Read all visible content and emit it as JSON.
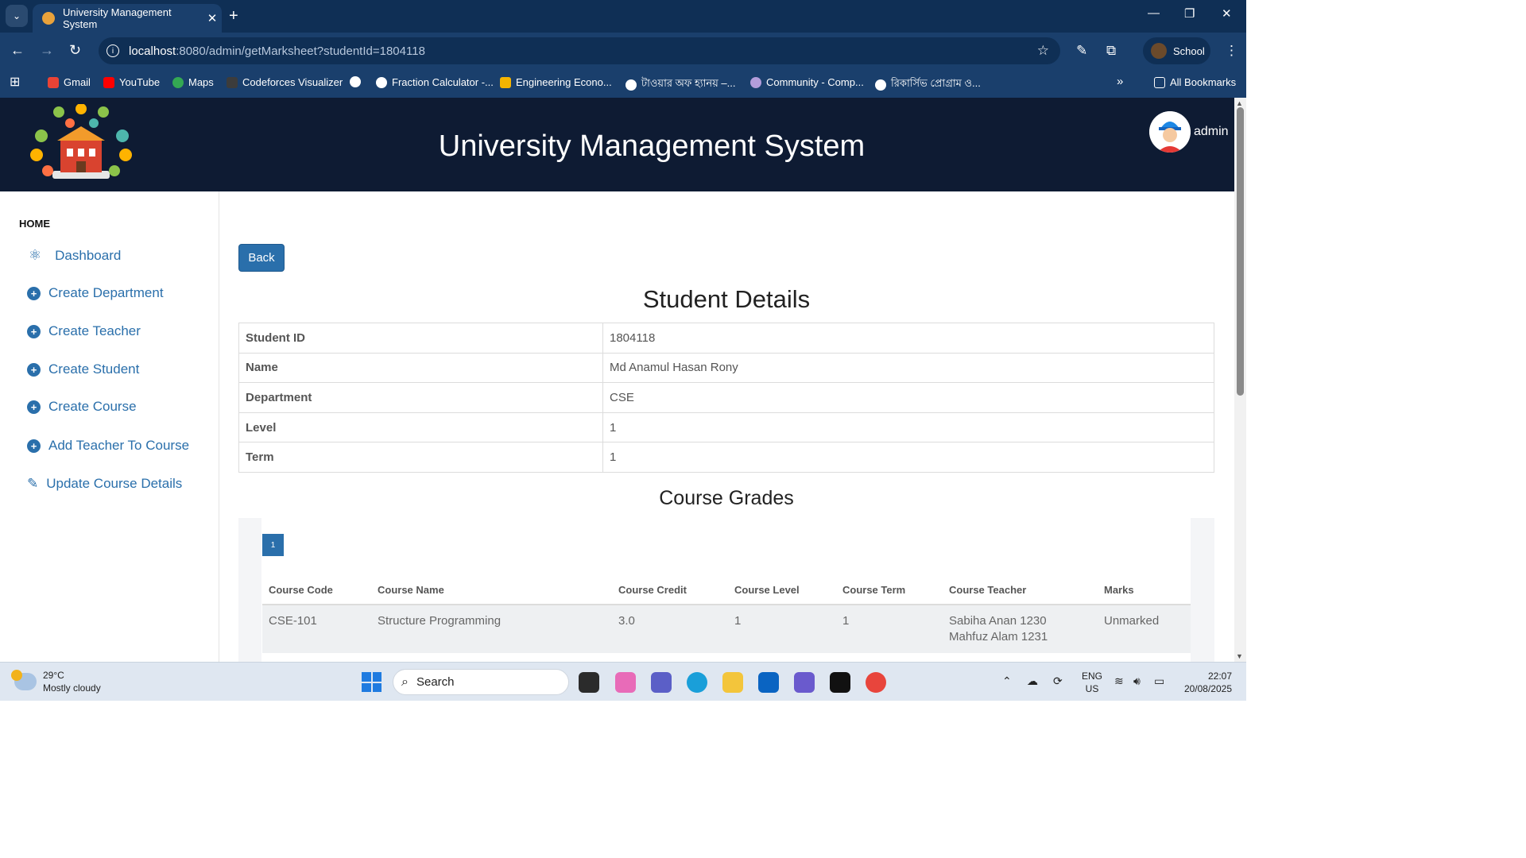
{
  "browser": {
    "tab_title": "University Management System",
    "url_host": "localhost",
    "url_path": ":8080/admin/getMarksheet?studentId=1804118",
    "profile_label": "School",
    "bookmarks": [
      "Gmail",
      "YouTube",
      "Maps",
      "Codeforces Visualizer",
      "Fraction Calculator -...",
      "Engineering Econo...",
      "টাওয়ার অফ হ্যানয় –...",
      "Community - Comp...",
      "রিকার্সিভ প্রোগ্রাম ও..."
    ],
    "all_bookmarks": "All Bookmarks"
  },
  "header": {
    "title": "University Management System",
    "user": "admin"
  },
  "sidebar": {
    "section": "HOME",
    "items": [
      {
        "label": "Dashboard",
        "icon": "atom-icon"
      },
      {
        "label": "Create Department",
        "icon": "plus-circle-icon"
      },
      {
        "label": "Create Teacher",
        "icon": "plus-circle-icon"
      },
      {
        "label": "Create Student",
        "icon": "plus-circle-icon"
      },
      {
        "label": "Create Course",
        "icon": "plus-circle-icon"
      },
      {
        "label": "Add Teacher To Course",
        "icon": "plus-circle-icon"
      },
      {
        "label": "Update Course Details",
        "icon": "edit-icon"
      }
    ]
  },
  "main": {
    "back_label": "Back",
    "details_heading": "Student Details",
    "details": [
      {
        "key": "Student ID",
        "value": "1804118"
      },
      {
        "key": "Name",
        "value": "Md Anamul Hasan Rony"
      },
      {
        "key": "Department",
        "value": "CSE"
      },
      {
        "key": "Level",
        "value": "1"
      },
      {
        "key": "Term",
        "value": "1"
      }
    ],
    "grades_heading": "Course Grades",
    "page_chip": "1",
    "grades_columns": [
      "Course Code",
      "Course Name",
      "Course Credit",
      "Course Level",
      "Course Term",
      "Course Teacher",
      "Marks"
    ],
    "grades_rows": [
      {
        "code": "CSE-101",
        "name": "Structure Programming",
        "credit": "3.0",
        "level": "1",
        "term": "1",
        "teacher1": "Sabiha Anan 1230",
        "teacher2": "Mahfuz Alam 1231",
        "marks": "Unmarked"
      }
    ]
  },
  "taskbar": {
    "temp": "29°C",
    "weather": "Mostly cloudy",
    "search_placeholder": "Search",
    "lang1": "ENG",
    "lang2": "US",
    "time": "22:07",
    "date": "20/08/2025"
  },
  "colors": {
    "accent": "#2a6fab",
    "header_bg": "#0e1b33",
    "chrome": "#1a3f6c"
  }
}
